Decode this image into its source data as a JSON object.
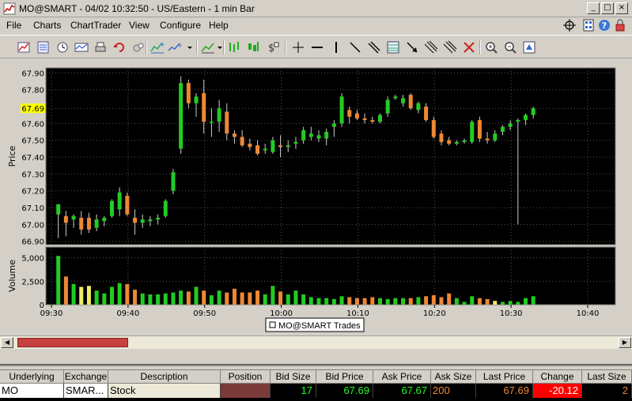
{
  "window": {
    "title": "MO@SMART - 04/02 10:32:50 - US/Eastern - 1 min Bar",
    "minimize": "_",
    "maximize": "□",
    "close": "×"
  },
  "menu": {
    "items": [
      "File",
      "Charts",
      "ChartTrader",
      "View",
      "Configure",
      "Help"
    ]
  },
  "toolbar": {
    "icons": [
      "new-chart-icon",
      "chart-data-icon",
      "clock-icon",
      "ruler-icon",
      "print-icon",
      "undo-icon",
      "link-icon",
      "indicator-icon",
      "drawing-icon",
      "trend-icon",
      "bar-style-icon",
      "dollar-icon",
      "crosshair-icon",
      "horizontal-line-icon",
      "vertical-line-icon",
      "diagonal-line-icon",
      "channel-icon",
      "fib-icon",
      "arrow-icon",
      "delete-drawing-icon",
      "zoom-in-icon",
      "zoom-out-icon",
      "auto-scale-icon"
    ]
  },
  "colors": {
    "up": "#22cc22",
    "down": "#ee8833",
    "volume_yellow": "#eeee66",
    "background": "#000000",
    "grid": "#555555",
    "last_price_highlight": "#ffff00",
    "change_negative": "#ff0000"
  },
  "chart_data": {
    "type": "candlestick",
    "title": "",
    "symbol_label": "MO@SMART Trades",
    "price_axis_label": "Price",
    "volume_axis_label": "Volume",
    "price_ticks": [
      "67.90",
      "67.80",
      "67.69",
      "67.60",
      "67.50",
      "67.40",
      "67.30",
      "67.20",
      "67.10",
      "67.00",
      "66.90"
    ],
    "price_tick_values": [
      67.9,
      67.8,
      67.69,
      67.6,
      67.5,
      67.4,
      67.3,
      67.2,
      67.1,
      67.0,
      66.9
    ],
    "highlighted_price": "67.69",
    "ylim_price": [
      66.88,
      67.93
    ],
    "volume_ticks": [
      "5,000",
      "2,500",
      "0"
    ],
    "volume_tick_values": [
      5000,
      2500,
      0
    ],
    "ylim_volume": [
      0,
      5800
    ],
    "time_ticks": [
      "09:30",
      "09:40",
      "09:50",
      "10:00",
      "10:10",
      "10:20",
      "10:30",
      "10:40"
    ],
    "bars": [
      {
        "t": "09:31",
        "o": 67.06,
        "h": 67.12,
        "l": 66.92,
        "c": 67.12,
        "v": 5200
      },
      {
        "t": "09:32",
        "o": 67.05,
        "h": 67.08,
        "l": 66.93,
        "c": 67.01,
        "v": 3000
      },
      {
        "t": "09:33",
        "o": 67.03,
        "h": 67.06,
        "l": 66.98,
        "c": 67.05,
        "v": 2200
      },
      {
        "t": "09:34",
        "o": 67.04,
        "h": 67.08,
        "l": 66.94,
        "c": 66.97,
        "v": 1900
      },
      {
        "t": "09:35",
        "o": 67.04,
        "h": 67.07,
        "l": 66.95,
        "c": 66.97,
        "v": 2000
      },
      {
        "t": "09:36",
        "o": 66.98,
        "h": 67.06,
        "l": 66.96,
        "c": 67.03,
        "v": 1500
      },
      {
        "t": "09:37",
        "o": 67.02,
        "h": 67.05,
        "l": 66.99,
        "c": 67.04,
        "v": 1200
      },
      {
        "t": "09:38",
        "o": 67.05,
        "h": 67.15,
        "l": 67.04,
        "c": 67.14,
        "v": 1900
      },
      {
        "t": "09:39",
        "o": 67.09,
        "h": 67.22,
        "l": 67.05,
        "c": 67.19,
        "v": 2300
      },
      {
        "t": "09:40",
        "o": 67.17,
        "h": 67.19,
        "l": 67.05,
        "c": 67.06,
        "v": 2200
      },
      {
        "t": "09:41",
        "o": 67.04,
        "h": 67.09,
        "l": 66.94,
        "c": 67.01,
        "v": 1600
      },
      {
        "t": "09:42",
        "o": 67.01,
        "h": 67.06,
        "l": 66.98,
        "c": 67.03,
        "v": 1200
      },
      {
        "t": "09:43",
        "o": 67.02,
        "h": 67.05,
        "l": 66.99,
        "c": 67.03,
        "v": 1100
      },
      {
        "t": "09:44",
        "o": 67.03,
        "h": 67.06,
        "l": 67.0,
        "c": 67.04,
        "v": 1100
      },
      {
        "t": "09:45",
        "o": 67.05,
        "h": 67.15,
        "l": 67.04,
        "c": 67.14,
        "v": 1200
      },
      {
        "t": "09:46",
        "o": 67.2,
        "h": 67.33,
        "l": 67.18,
        "c": 67.31,
        "v": 1300
      },
      {
        "t": "09:47",
        "o": 67.45,
        "h": 67.88,
        "l": 67.42,
        "c": 67.84,
        "v": 1500
      },
      {
        "t": "09:48",
        "o": 67.84,
        "h": 67.86,
        "l": 67.69,
        "c": 67.72,
        "v": 1400
      },
      {
        "t": "09:49",
        "o": 67.72,
        "h": 67.78,
        "l": 67.64,
        "c": 67.76,
        "v": 1900
      },
      {
        "t": "09:50",
        "o": 67.78,
        "h": 67.86,
        "l": 67.54,
        "c": 67.61,
        "v": 1500
      },
      {
        "t": "09:51",
        "o": 67.61,
        "h": 67.69,
        "l": 67.52,
        "c": 67.61,
        "v": 1000
      },
      {
        "t": "09:52",
        "o": 67.61,
        "h": 67.74,
        "l": 67.55,
        "c": 67.69,
        "v": 1500
      },
      {
        "t": "09:53",
        "o": 67.67,
        "h": 67.72,
        "l": 67.5,
        "c": 67.54,
        "v": 1300
      },
      {
        "t": "09:54",
        "o": 67.54,
        "h": 67.56,
        "l": 67.48,
        "c": 67.52,
        "v": 1700
      },
      {
        "t": "09:55",
        "o": 67.52,
        "h": 67.56,
        "l": 67.46,
        "c": 67.47,
        "v": 1300
      },
      {
        "t": "09:56",
        "o": 67.48,
        "h": 67.51,
        "l": 67.44,
        "c": 67.46,
        "v": 1300
      },
      {
        "t": "09:57",
        "o": 67.47,
        "h": 67.5,
        "l": 67.41,
        "c": 67.42,
        "v": 1500
      },
      {
        "t": "09:58",
        "o": 67.44,
        "h": 67.48,
        "l": 67.42,
        "c": 67.45,
        "v": 1100
      },
      {
        "t": "09:59",
        "o": 67.43,
        "h": 67.52,
        "l": 67.42,
        "c": 67.5,
        "v": 2000
      },
      {
        "t": "10:00",
        "o": 67.47,
        "h": 67.53,
        "l": 67.4,
        "c": 67.46,
        "v": 1400
      },
      {
        "t": "10:01",
        "o": 67.46,
        "h": 67.5,
        "l": 67.43,
        "c": 67.47,
        "v": 1100
      },
      {
        "t": "10:02",
        "o": 67.48,
        "h": 67.52,
        "l": 67.45,
        "c": 67.49,
        "v": 1500
      },
      {
        "t": "10:03",
        "o": 67.5,
        "h": 67.58,
        "l": 67.48,
        "c": 67.56,
        "v": 1100
      },
      {
        "t": "10:04",
        "o": 67.52,
        "h": 67.58,
        "l": 67.5,
        "c": 67.54,
        "v": 800
      },
      {
        "t": "10:05",
        "o": 67.51,
        "h": 67.56,
        "l": 67.49,
        "c": 67.53,
        "v": 700
      },
      {
        "t": "10:06",
        "o": 67.51,
        "h": 67.57,
        "l": 67.47,
        "c": 67.55,
        "v": 700
      },
      {
        "t": "10:07",
        "o": 67.58,
        "h": 67.62,
        "l": 67.52,
        "c": 67.6,
        "v": 600
      },
      {
        "t": "10:08",
        "o": 67.6,
        "h": 67.78,
        "l": 67.58,
        "c": 67.76,
        "v": 900
      },
      {
        "t": "10:09",
        "o": 67.68,
        "h": 67.7,
        "l": 67.6,
        "c": 67.64,
        "v": 800
      },
      {
        "t": "10:10",
        "o": 67.66,
        "h": 67.68,
        "l": 67.62,
        "c": 67.63,
        "v": 700
      },
      {
        "t": "10:11",
        "o": 67.63,
        "h": 67.66,
        "l": 67.6,
        "c": 67.62,
        "v": 700
      },
      {
        "t": "10:12",
        "o": 67.62,
        "h": 67.64,
        "l": 67.6,
        "c": 67.61,
        "v": 800
      },
      {
        "t": "10:13",
        "o": 67.61,
        "h": 67.66,
        "l": 67.6,
        "c": 67.65,
        "v": 700
      },
      {
        "t": "10:14",
        "o": 67.66,
        "h": 67.76,
        "l": 67.64,
        "c": 67.74,
        "v": 600
      },
      {
        "t": "10:15",
        "o": 67.75,
        "h": 67.77,
        "l": 67.74,
        "c": 67.76,
        "v": 700
      },
      {
        "t": "10:16",
        "o": 67.72,
        "h": 67.77,
        "l": 67.7,
        "c": 67.75,
        "v": 700
      },
      {
        "t": "10:17",
        "o": 67.77,
        "h": 67.78,
        "l": 67.68,
        "c": 67.69,
        "v": 700
      },
      {
        "t": "10:18",
        "o": 67.68,
        "h": 67.73,
        "l": 67.66,
        "c": 67.72,
        "v": 800
      },
      {
        "t": "10:19",
        "o": 67.7,
        "h": 67.72,
        "l": 67.61,
        "c": 67.62,
        "v": 900
      },
      {
        "t": "10:20",
        "o": 67.62,
        "h": 67.64,
        "l": 67.51,
        "c": 67.52,
        "v": 1000
      },
      {
        "t": "10:21",
        "o": 67.54,
        "h": 67.56,
        "l": 67.47,
        "c": 67.49,
        "v": 800
      },
      {
        "t": "10:22",
        "o": 67.5,
        "h": 67.52,
        "l": 67.47,
        "c": 67.48,
        "v": 1200
      },
      {
        "t": "10:23",
        "o": 67.48,
        "h": 67.5,
        "l": 67.47,
        "c": 67.49,
        "v": 700
      },
      {
        "t": "10:24",
        "o": 67.49,
        "h": 67.51,
        "l": 67.48,
        "c": 67.5,
        "v": 300
      },
      {
        "t": "10:25",
        "o": 67.49,
        "h": 67.62,
        "l": 67.48,
        "c": 67.61,
        "v": 900
      },
      {
        "t": "10:26",
        "o": 67.62,
        "h": 67.64,
        "l": 67.49,
        "c": 67.51,
        "v": 700
      },
      {
        "t": "10:27",
        "o": 67.51,
        "h": 67.55,
        "l": 67.48,
        "c": 67.5,
        "v": 600
      },
      {
        "t": "10:28",
        "o": 67.5,
        "h": 67.56,
        "l": 67.49,
        "c": 67.54,
        "v": 400
      },
      {
        "t": "10:29",
        "o": 67.55,
        "h": 67.59,
        "l": 67.53,
        "c": 67.58,
        "v": 300
      },
      {
        "t": "10:30",
        "o": 67.58,
        "h": 67.62,
        "l": 67.56,
        "c": 67.6,
        "v": 400
      },
      {
        "t": "10:31",
        "o": 67.61,
        "h": 67.63,
        "l": 67.0,
        "c": 67.62,
        "v": 300
      },
      {
        "t": "10:32",
        "o": 67.62,
        "h": 67.66,
        "l": 67.59,
        "c": 67.65,
        "v": 700
      },
      {
        "t": "10:33",
        "o": 67.65,
        "h": 67.7,
        "l": 67.63,
        "c": 67.69,
        "v": 900
      }
    ],
    "volume_highlight_colors": {
      "3": "yellow",
      "4": "yellow",
      "57": "yellow"
    }
  },
  "market_data": {
    "headers": [
      "Underlying",
      "Exchange",
      "Description",
      "Position",
      "Bid Size",
      "Bid Price",
      "Ask Price",
      "Ask Size",
      "Last Price",
      "Change",
      "Last Size"
    ],
    "row": {
      "underlying": "MO",
      "exchange": "SMAR...",
      "description": "Stock",
      "position": "",
      "bid_size": "17",
      "bid_price": "67.69",
      "ask_price": "67.67",
      "ask_size": "200",
      "last_price": "67.69",
      "change": "-20.12",
      "last_size": "2"
    }
  }
}
